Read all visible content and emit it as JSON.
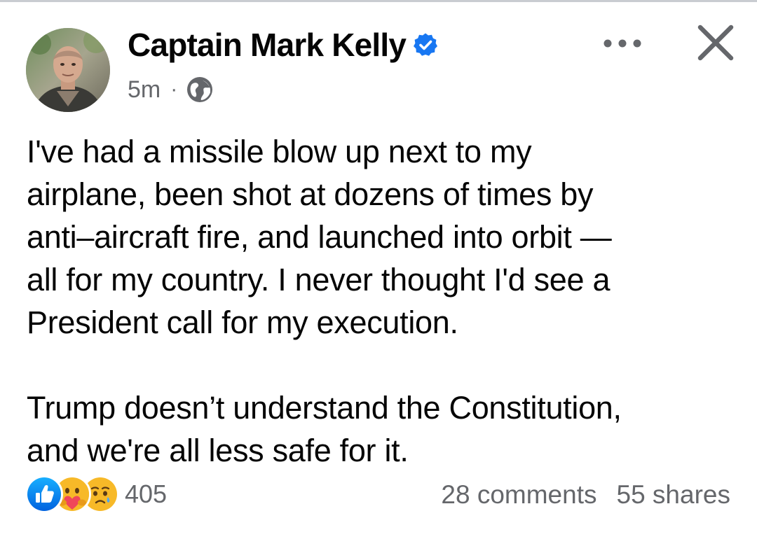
{
  "post": {
    "author": {
      "name": "Captain Mark Kelly",
      "verified": true,
      "avatar_icon": "profile-photo"
    },
    "meta": {
      "time": "5m",
      "separator": "·",
      "audience_icon": "globe-icon"
    },
    "header_actions": {
      "more_icon": "more-horizontal-icon",
      "close_icon": "close-icon"
    },
    "paragraphs": [
      "I've had a missile blow up next to my\nairplane, been shot at dozens of times by\nanti–aircraft fire, and launched into orbit —\nall for my country. I never thought I'd see a\nPresident call for my execution.",
      "Trump doesn’t understand the Constitution,\nand we're all less safe for it."
    ],
    "footer": {
      "reaction_icons": [
        "like-icon",
        "care-icon",
        "sad-icon"
      ],
      "reaction_count": "405",
      "comments": "28 comments",
      "shares": "55 shares"
    }
  },
  "colors": {
    "text_primary": "#050505",
    "text_secondary": "#65676b",
    "facebook_blue": "#1877f2",
    "reaction_yellow": "#f7b928"
  }
}
